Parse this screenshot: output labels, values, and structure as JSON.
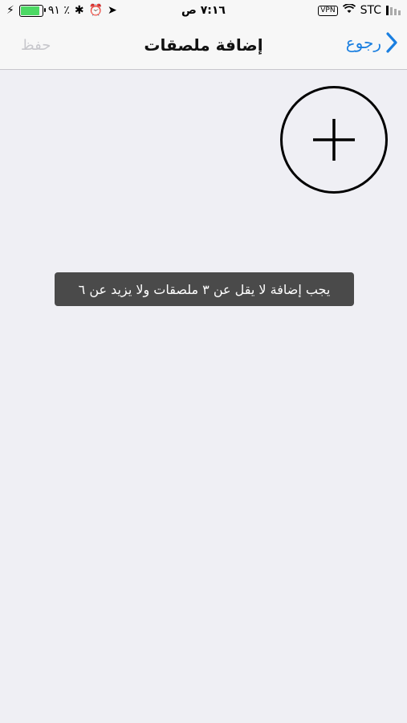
{
  "status_bar": {
    "battery_percent": "٩١ ٪",
    "time": "٧:١٦ ص",
    "vpn": "VPN",
    "carrier": "STC"
  },
  "nav": {
    "title": "إضافة ملصقات",
    "back_label": "رجوع",
    "save_label": "حفظ"
  },
  "toast": {
    "message": "يجب إضافة لا يقل عن ٣ ملصقات ولا يزيد عن ٦"
  },
  "icons": {
    "add": "plus-icon",
    "back": "chevron-right-icon"
  },
  "colors": {
    "accent": "#1a7fe0",
    "battery": "#4cd964",
    "toast_bg": "#4a4a4a"
  }
}
